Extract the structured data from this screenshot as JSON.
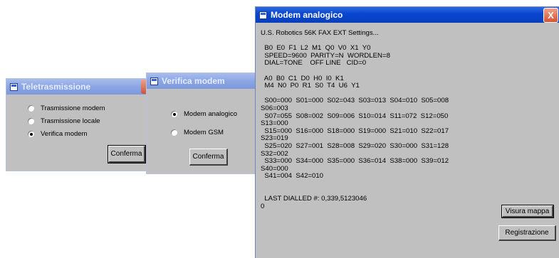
{
  "tele": {
    "title": "Teletrasmissione",
    "options": [
      "Trasmissione modem",
      "Trasmissione locale",
      "Verifica modem"
    ],
    "selected_index": 2,
    "confirm": "Conferma"
  },
  "verifica": {
    "title": "Verifica modem",
    "options": [
      "Modem analogico",
      "Modem GSM"
    ],
    "selected_index": 0,
    "confirm": "Conferma"
  },
  "modem": {
    "title": "Modem  analogico",
    "close": "X",
    "settings_text": "U.S. Robotics 56K FAX EXT Settings...\n\n  B0  E0  F1  L2  M1  Q0  V0  X1  Y0\n  SPEED=9600  PARITY=N  WORDLEN=8\n  DIAL=TONE    OFF LINE   CID=0\n\n  A0  B0  C1  D0  H0  I0  K1\n  M4  N0  P0  R1  S0  T4  U6  Y1\n\n  S00=000  S01=000  S02=043  S03=013  S04=010  S05=008\nS06=003\n  S07=055  S08=002  S09=006  S10=014  S11=072  S12=050\nS13=000\n  S15=000  S16=000  S18=000  S19=000  S21=010  S22=017\nS23=019\n  S25=020  S27=001  S28=008  S29=020  S30=000  S31=128\nS32=002\n  S33=000  S34=000  S35=000  S36=014  S38=000  S39=012\nS40=000\n  S41=004  S42=010\n\n\n  LAST DIALLED #: 0,339,5123046\n0",
    "visura": "Visura mappa",
    "registrazione": "Registrazione"
  }
}
